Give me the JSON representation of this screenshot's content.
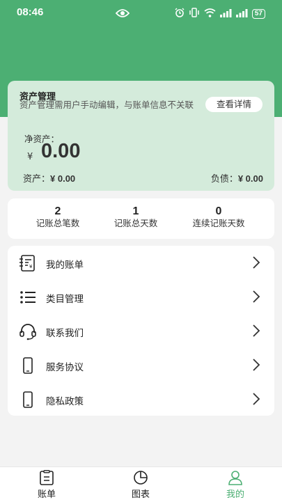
{
  "status_bar": {
    "time": "08:46",
    "battery": "57"
  },
  "asset_card": {
    "title": "资产管理",
    "description": "资产管理需用户手动编辑，与账单信息不关联",
    "detail_button": "查看详情",
    "net_label": "净资产：",
    "currency": "¥",
    "net_value": "0.00",
    "assets_label": "资产：",
    "assets_value": "¥ 0.00",
    "debt_label": "负债：",
    "debt_value": "¥ 0.00"
  },
  "stats": [
    {
      "value": "2",
      "label": "记账总笔数"
    },
    {
      "value": "1",
      "label": "记账总天数"
    },
    {
      "value": "0",
      "label": "连续记账天数"
    }
  ],
  "menu": [
    {
      "label": "我的账单",
      "icon": "bill-icon"
    },
    {
      "label": "类目管理",
      "icon": "list-icon"
    },
    {
      "label": "联系我们",
      "icon": "headset-icon"
    },
    {
      "label": "服务协议",
      "icon": "phone-icon"
    },
    {
      "label": "隐私政策",
      "icon": "phone-icon"
    }
  ],
  "tabs": [
    {
      "label": "账单",
      "icon": "clipboard-icon",
      "active": false
    },
    {
      "label": "图表",
      "icon": "pie-chart-icon",
      "active": false
    },
    {
      "label": "我的",
      "icon": "user-icon",
      "active": true
    }
  ],
  "colors": {
    "primary": "#4caf73",
    "card_tint": "#d4ebdb"
  }
}
